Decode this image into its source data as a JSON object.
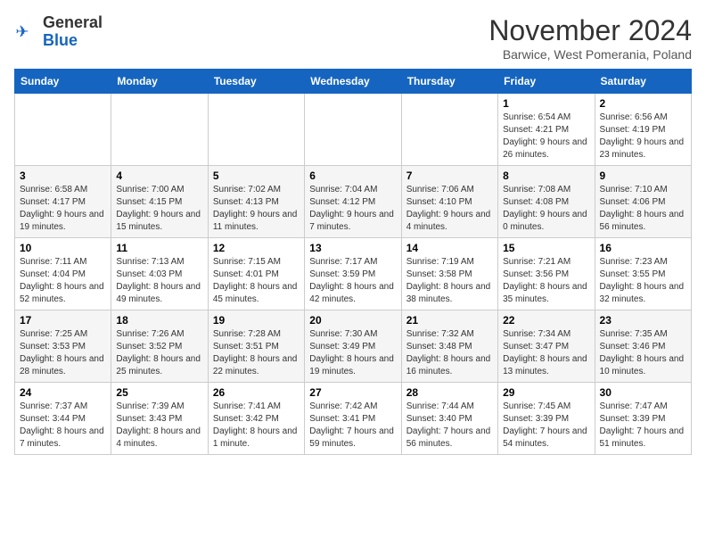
{
  "logo": {
    "general": "General",
    "blue": "Blue"
  },
  "title": "November 2024",
  "subtitle": "Barwice, West Pomerania, Poland",
  "days_of_week": [
    "Sunday",
    "Monday",
    "Tuesday",
    "Wednesday",
    "Thursday",
    "Friday",
    "Saturday"
  ],
  "weeks": [
    [
      {
        "day": "",
        "info": ""
      },
      {
        "day": "",
        "info": ""
      },
      {
        "day": "",
        "info": ""
      },
      {
        "day": "",
        "info": ""
      },
      {
        "day": "",
        "info": ""
      },
      {
        "day": "1",
        "info": "Sunrise: 6:54 AM\nSunset: 4:21 PM\nDaylight: 9 hours and 26 minutes."
      },
      {
        "day": "2",
        "info": "Sunrise: 6:56 AM\nSunset: 4:19 PM\nDaylight: 9 hours and 23 minutes."
      }
    ],
    [
      {
        "day": "3",
        "info": "Sunrise: 6:58 AM\nSunset: 4:17 PM\nDaylight: 9 hours and 19 minutes."
      },
      {
        "day": "4",
        "info": "Sunrise: 7:00 AM\nSunset: 4:15 PM\nDaylight: 9 hours and 15 minutes."
      },
      {
        "day": "5",
        "info": "Sunrise: 7:02 AM\nSunset: 4:13 PM\nDaylight: 9 hours and 11 minutes."
      },
      {
        "day": "6",
        "info": "Sunrise: 7:04 AM\nSunset: 4:12 PM\nDaylight: 9 hours and 7 minutes."
      },
      {
        "day": "7",
        "info": "Sunrise: 7:06 AM\nSunset: 4:10 PM\nDaylight: 9 hours and 4 minutes."
      },
      {
        "day": "8",
        "info": "Sunrise: 7:08 AM\nSunset: 4:08 PM\nDaylight: 9 hours and 0 minutes."
      },
      {
        "day": "9",
        "info": "Sunrise: 7:10 AM\nSunset: 4:06 PM\nDaylight: 8 hours and 56 minutes."
      }
    ],
    [
      {
        "day": "10",
        "info": "Sunrise: 7:11 AM\nSunset: 4:04 PM\nDaylight: 8 hours and 52 minutes."
      },
      {
        "day": "11",
        "info": "Sunrise: 7:13 AM\nSunset: 4:03 PM\nDaylight: 8 hours and 49 minutes."
      },
      {
        "day": "12",
        "info": "Sunrise: 7:15 AM\nSunset: 4:01 PM\nDaylight: 8 hours and 45 minutes."
      },
      {
        "day": "13",
        "info": "Sunrise: 7:17 AM\nSunset: 3:59 PM\nDaylight: 8 hours and 42 minutes."
      },
      {
        "day": "14",
        "info": "Sunrise: 7:19 AM\nSunset: 3:58 PM\nDaylight: 8 hours and 38 minutes."
      },
      {
        "day": "15",
        "info": "Sunrise: 7:21 AM\nSunset: 3:56 PM\nDaylight: 8 hours and 35 minutes."
      },
      {
        "day": "16",
        "info": "Sunrise: 7:23 AM\nSunset: 3:55 PM\nDaylight: 8 hours and 32 minutes."
      }
    ],
    [
      {
        "day": "17",
        "info": "Sunrise: 7:25 AM\nSunset: 3:53 PM\nDaylight: 8 hours and 28 minutes."
      },
      {
        "day": "18",
        "info": "Sunrise: 7:26 AM\nSunset: 3:52 PM\nDaylight: 8 hours and 25 minutes."
      },
      {
        "day": "19",
        "info": "Sunrise: 7:28 AM\nSunset: 3:51 PM\nDaylight: 8 hours and 22 minutes."
      },
      {
        "day": "20",
        "info": "Sunrise: 7:30 AM\nSunset: 3:49 PM\nDaylight: 8 hours and 19 minutes."
      },
      {
        "day": "21",
        "info": "Sunrise: 7:32 AM\nSunset: 3:48 PM\nDaylight: 8 hours and 16 minutes."
      },
      {
        "day": "22",
        "info": "Sunrise: 7:34 AM\nSunset: 3:47 PM\nDaylight: 8 hours and 13 minutes."
      },
      {
        "day": "23",
        "info": "Sunrise: 7:35 AM\nSunset: 3:46 PM\nDaylight: 8 hours and 10 minutes."
      }
    ],
    [
      {
        "day": "24",
        "info": "Sunrise: 7:37 AM\nSunset: 3:44 PM\nDaylight: 8 hours and 7 minutes."
      },
      {
        "day": "25",
        "info": "Sunrise: 7:39 AM\nSunset: 3:43 PM\nDaylight: 8 hours and 4 minutes."
      },
      {
        "day": "26",
        "info": "Sunrise: 7:41 AM\nSunset: 3:42 PM\nDaylight: 8 hours and 1 minute."
      },
      {
        "day": "27",
        "info": "Sunrise: 7:42 AM\nSunset: 3:41 PM\nDaylight: 7 hours and 59 minutes."
      },
      {
        "day": "28",
        "info": "Sunrise: 7:44 AM\nSunset: 3:40 PM\nDaylight: 7 hours and 56 minutes."
      },
      {
        "day": "29",
        "info": "Sunrise: 7:45 AM\nSunset: 3:39 PM\nDaylight: 7 hours and 54 minutes."
      },
      {
        "day": "30",
        "info": "Sunrise: 7:47 AM\nSunset: 3:39 PM\nDaylight: 7 hours and 51 minutes."
      }
    ]
  ]
}
